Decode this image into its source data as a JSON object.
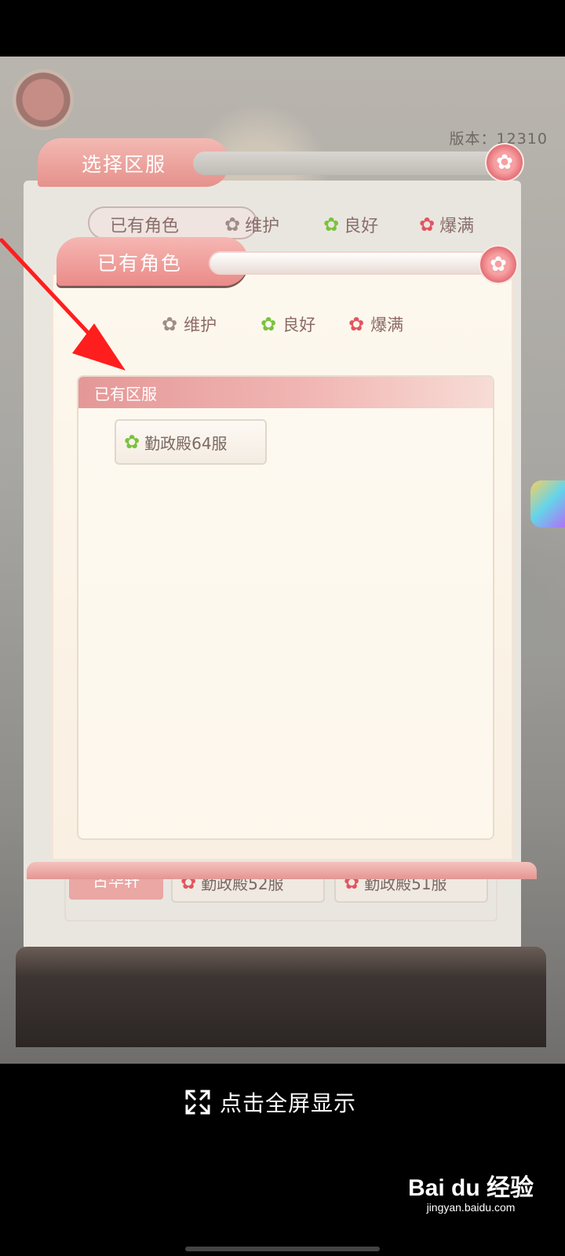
{
  "scene": {
    "version_text": "版本：12310"
  },
  "back_dialog": {
    "tab_label": "选择区服",
    "filters": [
      {
        "label": "已有角色",
        "icon": "avatar-icon"
      },
      {
        "label": "维护",
        "icon": "flower-gray-icon",
        "color": "#a08c88"
      },
      {
        "label": "良好",
        "icon": "flower-green-icon",
        "color": "#7ac23c"
      },
      {
        "label": "爆满",
        "icon": "flower-red-icon",
        "color": "#e2555f"
      }
    ]
  },
  "front_dialog": {
    "tab_label": "已有角色",
    "legend": [
      {
        "label": "维护",
        "icon": "flower-gray-icon",
        "color": "#a08c88"
      },
      {
        "label": "良好",
        "icon": "flower-green-icon",
        "color": "#7ac23c"
      },
      {
        "label": "爆满",
        "icon": "flower-red-icon",
        "color": "#e2555f"
      }
    ],
    "owned_section_title": "已有区服",
    "owned_servers": [
      {
        "label": "勤政殿64服",
        "status": "良好",
        "color": "#7ac23c"
      }
    ]
  },
  "lower_list": {
    "group_tab": "古华轩",
    "servers": [
      {
        "label": "勤政殿52服",
        "color": "#e2555f"
      },
      {
        "label": "勤政殿51服",
        "color": "#e2555f"
      }
    ]
  },
  "fullscreen": {
    "label": "点击全屏显示"
  },
  "watermark": {
    "main": "Bai du 经验",
    "sub": "jingyan.baidu.com"
  }
}
